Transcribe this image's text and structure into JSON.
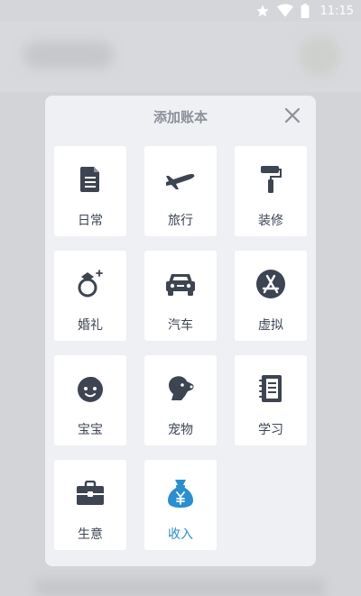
{
  "status_bar": {
    "time": "11:15",
    "icons": [
      "star-icon",
      "wifi-icon",
      "battery-icon"
    ]
  },
  "dialog": {
    "title": "添加账本",
    "close_icon": "close-icon",
    "tiles": [
      {
        "label": "日常",
        "icon": "document-icon"
      },
      {
        "label": "旅行",
        "icon": "airplane-icon"
      },
      {
        "label": "装修",
        "icon": "paint-roller-icon"
      },
      {
        "label": "婚礼",
        "icon": "ring-icon"
      },
      {
        "label": "汽车",
        "icon": "car-icon"
      },
      {
        "label": "虚拟",
        "icon": "app-store-icon"
      },
      {
        "label": "宝宝",
        "icon": "baby-face-icon"
      },
      {
        "label": "宠物",
        "icon": "dog-icon"
      },
      {
        "label": "学习",
        "icon": "notebook-icon"
      },
      {
        "label": "生意",
        "icon": "briefcase-icon"
      },
      {
        "label": "收入",
        "icon": "money-bag-icon"
      }
    ]
  },
  "colors": {
    "icon": "#3d4452",
    "accent": "#2a8fd0",
    "title": "#8c9099",
    "dialog_bg": "#eff0f4"
  }
}
